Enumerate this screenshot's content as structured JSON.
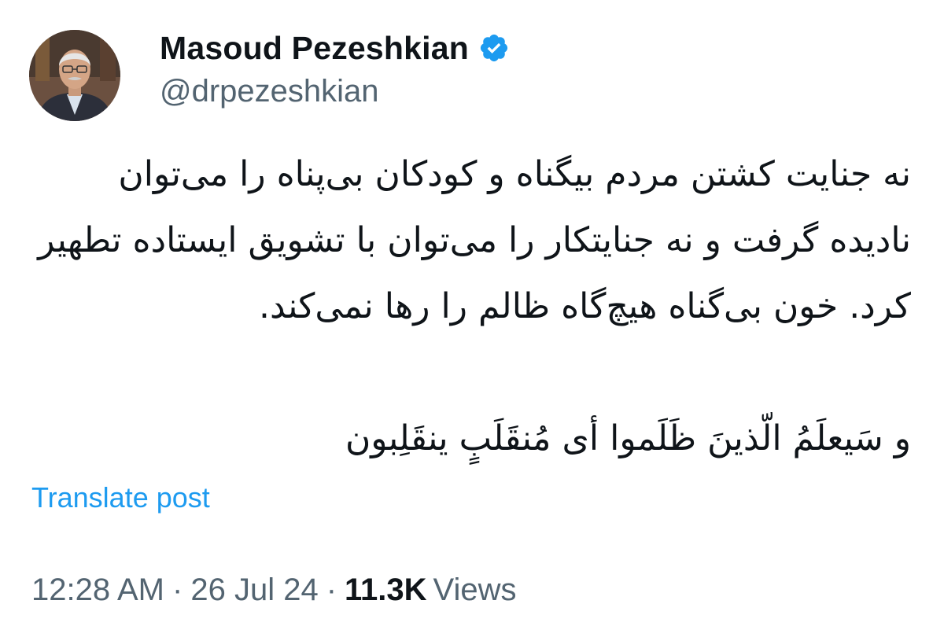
{
  "author": {
    "display_name": "Masoud Pezeshkian",
    "handle": "@drpezeshkian",
    "verified": true,
    "avatar_icon": "profile-photo"
  },
  "post": {
    "paragraph_1": "نه جنایت کشتن مردم بیگناه و کودکان بی‌پناه را می‌توان نادیده گرفت و نه جنایتکار را می‌توان با تشویق ایستاده تطهیر کرد. خون بی‌گناه هیچ‌گاه ظالم را رها نمی‌کند.",
    "paragraph_2": "و سَیعلَمُ الّذینَ ظَلَموا أی مُنقَلَبٍ ینقَلِبون"
  },
  "translate_label": "Translate post",
  "meta": {
    "time": "12:28 AM",
    "separator": "·",
    "date": "26 Jul 24",
    "views_count": "11.3K",
    "views_label": "Views"
  },
  "colors": {
    "text_primary": "#0f1419",
    "text_secondary": "#536471",
    "link": "#1d9bf0",
    "verified_badge": "#1d9bf0"
  }
}
